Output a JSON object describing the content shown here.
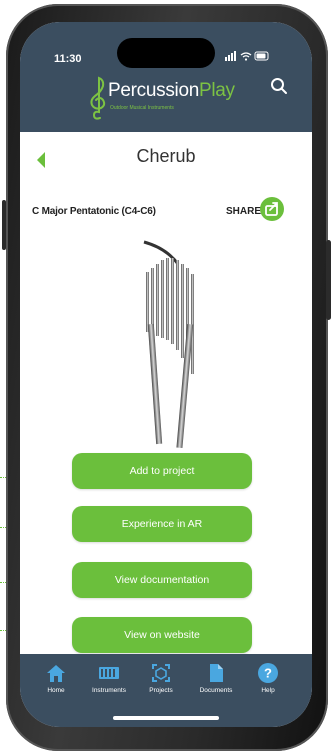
{
  "status_bar": {
    "time": "11:30",
    "icons": "signal wifi battery"
  },
  "header": {
    "logo_main": "Percussion",
    "logo_accent": "Play",
    "logo_tagline": "Outdoor Musical Instruments",
    "search_icon": "search-icon"
  },
  "page": {
    "title": "Cherub",
    "subtitle": "C Major Pentatonic (C4-C6)",
    "share_label": "SHARE"
  },
  "actions": [
    {
      "label": "Add to project"
    },
    {
      "label": "Experience in AR"
    },
    {
      "label": "View documentation"
    },
    {
      "label": "View on website"
    }
  ],
  "nav": [
    {
      "label": "Home",
      "icon": "home-icon"
    },
    {
      "label": "Instruments",
      "icon": "instruments-icon"
    },
    {
      "label": "Projects",
      "icon": "projects-icon"
    },
    {
      "label": "Documents",
      "icon": "document-icon"
    },
    {
      "label": "Help",
      "icon": "help-icon"
    }
  ],
  "colors": {
    "brand_dark": "#3b4e60",
    "accent_green": "#6bbf3c",
    "frame": "#2a2a2a"
  }
}
